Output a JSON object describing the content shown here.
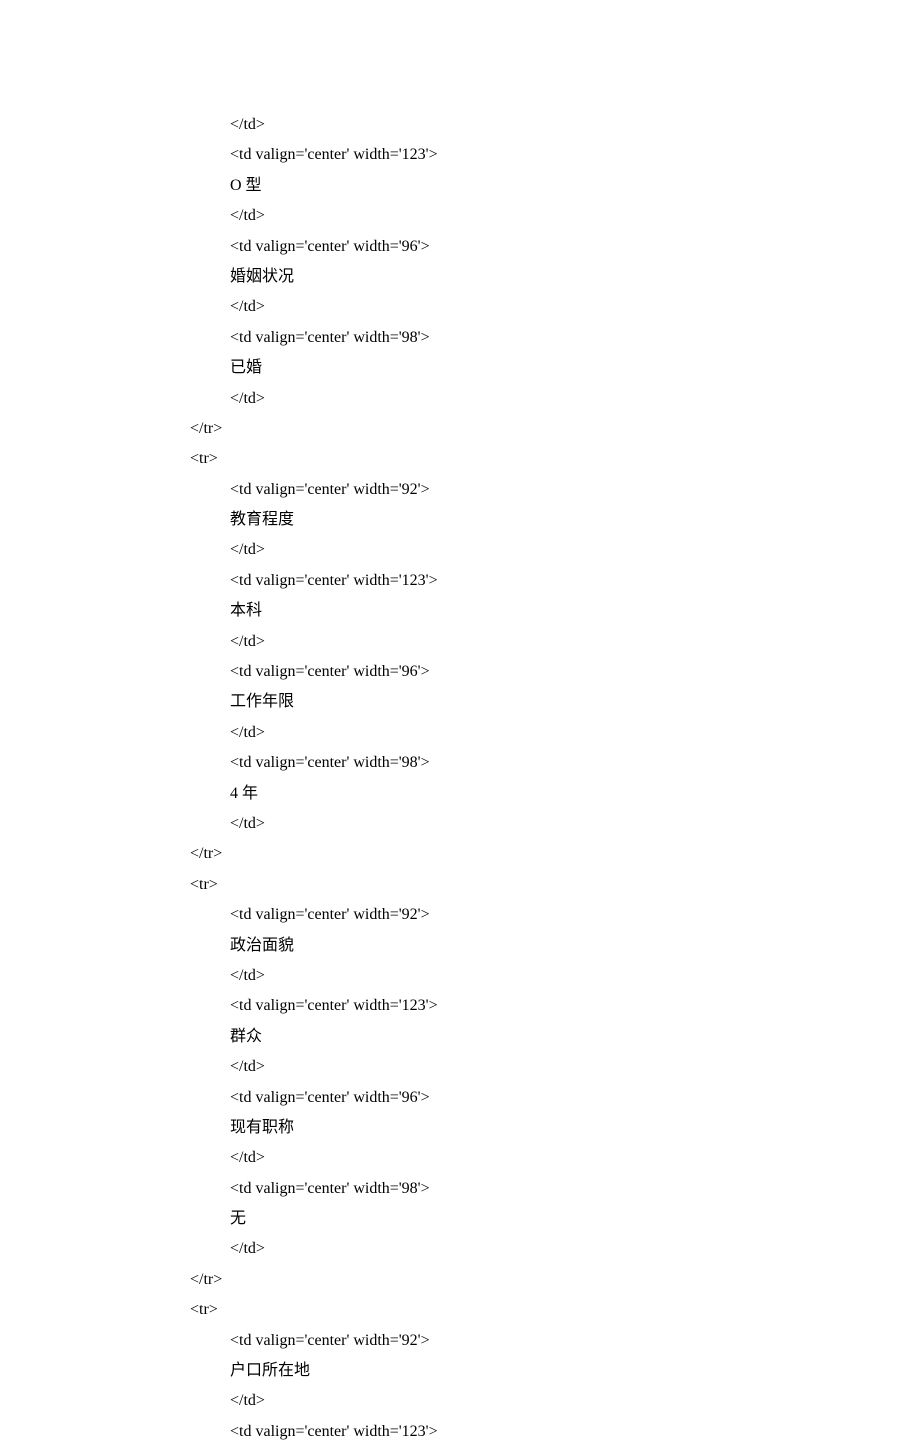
{
  "lines": [
    {
      "indent": 2,
      "text": "</td>"
    },
    {
      "indent": 2,
      "text": "<td valign='center' width='123'>"
    },
    {
      "indent": 2,
      "text": "O 型"
    },
    {
      "indent": 2,
      "text": "</td>"
    },
    {
      "indent": 2,
      "text": "<td valign='center' width='96'>"
    },
    {
      "indent": 2,
      "text": "婚姻状况"
    },
    {
      "indent": 2,
      "text": "</td>"
    },
    {
      "indent": 2,
      "text": "<td valign='center' width='98'>"
    },
    {
      "indent": 2,
      "text": "已婚"
    },
    {
      "indent": 2,
      "text": "</td>"
    },
    {
      "indent": 1,
      "text": "</tr>"
    },
    {
      "indent": 1,
      "text": "<tr>"
    },
    {
      "indent": 2,
      "text": "<td valign='center' width='92'>"
    },
    {
      "indent": 2,
      "text": "教育程度"
    },
    {
      "indent": 2,
      "text": "</td>"
    },
    {
      "indent": 2,
      "text": "<td valign='center' width='123'>"
    },
    {
      "indent": 2,
      "text": "本科"
    },
    {
      "indent": 2,
      "text": "</td>"
    },
    {
      "indent": 2,
      "text": "<td valign='center' width='96'>"
    },
    {
      "indent": 2,
      "text": "工作年限"
    },
    {
      "indent": 2,
      "text": "</td>"
    },
    {
      "indent": 2,
      "text": "<td valign='center' width='98'>"
    },
    {
      "indent": 2,
      "text": "4 年"
    },
    {
      "indent": 2,
      "text": "</td>"
    },
    {
      "indent": 1,
      "text": "</tr>"
    },
    {
      "indent": 1,
      "text": "<tr>"
    },
    {
      "indent": 2,
      "text": "<td valign='center' width='92'>"
    },
    {
      "indent": 2,
      "text": "政治面貌"
    },
    {
      "indent": 2,
      "text": "</td>"
    },
    {
      "indent": 2,
      "text": "<td valign='center' width='123'>"
    },
    {
      "indent": 2,
      "text": "群众"
    },
    {
      "indent": 2,
      "text": "</td>"
    },
    {
      "indent": 2,
      "text": "<td valign='center' width='96'>"
    },
    {
      "indent": 2,
      "text": "现有职称"
    },
    {
      "indent": 2,
      "text": "</td>"
    },
    {
      "indent": 2,
      "text": "<td valign='center' width='98'>"
    },
    {
      "indent": 2,
      "text": "无"
    },
    {
      "indent": 2,
      "text": "</td>"
    },
    {
      "indent": 1,
      "text": "</tr>"
    },
    {
      "indent": 1,
      "text": "<tr>"
    },
    {
      "indent": 2,
      "text": "<td valign='center' width='92'>"
    },
    {
      "indent": 2,
      "text": "户口所在地"
    },
    {
      "indent": 2,
      "text": "</td>"
    },
    {
      "indent": 2,
      "text": "<td valign='center' width='123'>"
    }
  ]
}
